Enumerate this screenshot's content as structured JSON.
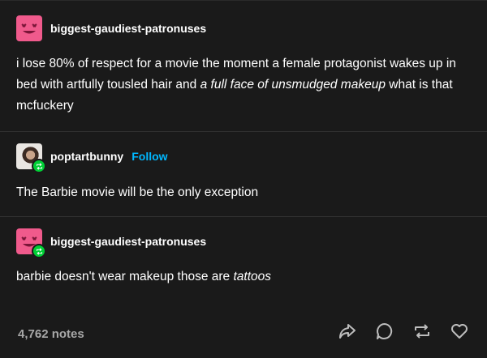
{
  "posts": [
    {
      "username": "biggest-gaudiest-patronuses",
      "text_parts": {
        "normal1": "i lose 80% of respect for a movie the moment a female protagonist wakes up in bed with artfully tousled hair and ",
        "italic1": "a full face of unsmudged makeup",
        "normal2": " what is that mcfuckery"
      }
    },
    {
      "username": "poptartbunny",
      "follow_label": "Follow",
      "text": "The Barbie movie will be the only exception"
    },
    {
      "username": "biggest-gaudiest-patronuses",
      "text_parts": {
        "normal1": "barbie doesn't wear makeup those are ",
        "italic1": "tattoos"
      }
    }
  ],
  "footer": {
    "notes": "4,762 notes"
  },
  "colors": {
    "background": "#1a1a1a",
    "avatar_pink": "#f05a8c",
    "follow_blue": "#00b8ff",
    "reblog_green": "#00cf35"
  },
  "icons": [
    "share-icon",
    "reply-icon",
    "reblog-icon",
    "like-icon"
  ]
}
